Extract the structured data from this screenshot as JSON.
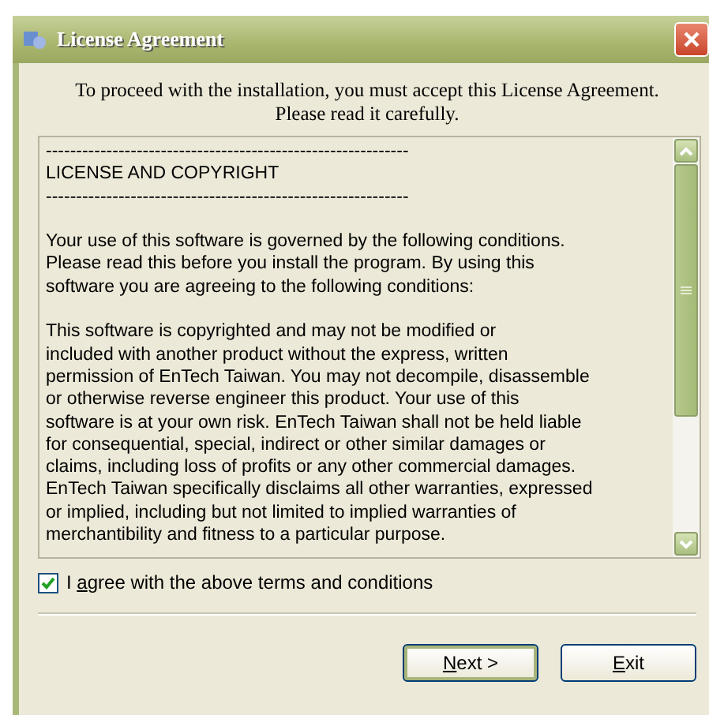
{
  "window": {
    "title": "License Agreement"
  },
  "intro": "To proceed with the installation, you must accept this License Agreement.\nPlease read it carefully.",
  "license_text": [
    "------------------------------------------------------------\nLICENSE AND COPYRIGHT\n------------------------------------------------------------",
    "Your use of this software is governed by the following conditions.\nPlease read this before you install the program. By using this\nsoftware you are agreeing to the following conditions:",
    "This software is copyrighted and may not be modified or\nincluded with another product without the express, written\npermission of EnTech Taiwan. You may not decompile, disassemble\nor otherwise reverse engineer this product. Your use of this\nsoftware is at your own risk. EnTech Taiwan shall not be held liable\nfor consequential, special, indirect or other similar damages or\nclaims, including loss of profits or any other commercial damages.\nEnTech Taiwan specifically disclaims all other warranties, expressed\nor implied, including but not limited to implied warranties of\nmerchantibility and fitness to a particular purpose."
  ],
  "agree": {
    "label_start": "I ",
    "access_key": "a",
    "label_end": "gree with the above terms and conditions",
    "checked": true
  },
  "buttons": [
    {
      "access_key": "N",
      "label_end": "ext >",
      "default": true
    },
    {
      "access_key": "E",
      "label_end": "xit",
      "default": false
    }
  ]
}
